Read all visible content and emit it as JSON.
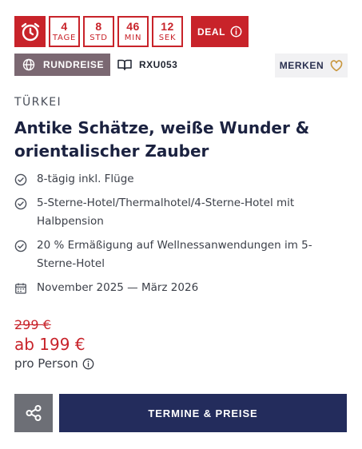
{
  "countdown": {
    "units": [
      {
        "value": "4",
        "label": "TAGE"
      },
      {
        "value": "8",
        "label": "STD"
      },
      {
        "value": "46",
        "label": "MIN"
      },
      {
        "value": "12",
        "label": "SEK"
      }
    ],
    "deal_label": "DEAL"
  },
  "tags": {
    "type_label": "RUNDREISE",
    "code": "RXU053",
    "merken_label": "MERKEN"
  },
  "offer": {
    "country": "TÜRKEI",
    "title": "Antike Schätze, weiße Wunder & orientalischer Zauber",
    "features": [
      "8-tägig inkl. Flüge",
      "5-Sterne-Hotel/Thermalhotel/4-Sterne-Hotel mit Halbpension",
      "20 % Ermäßigung auf Wellnessanwendungen im 5-Sterne-Hotel"
    ],
    "period": "November 2025 — März 2026"
  },
  "price": {
    "old": "299 €",
    "new": "ab 199 €",
    "per_person": "pro Person"
  },
  "actions": {
    "cta_label": "TERMINE & PREISE"
  },
  "colors": {
    "accent_red": "#c8232a",
    "badge_mauve": "#7b6872",
    "cta_navy": "#232c5c",
    "share_gray": "#6d6f76",
    "merken_heart": "#c8963c"
  }
}
